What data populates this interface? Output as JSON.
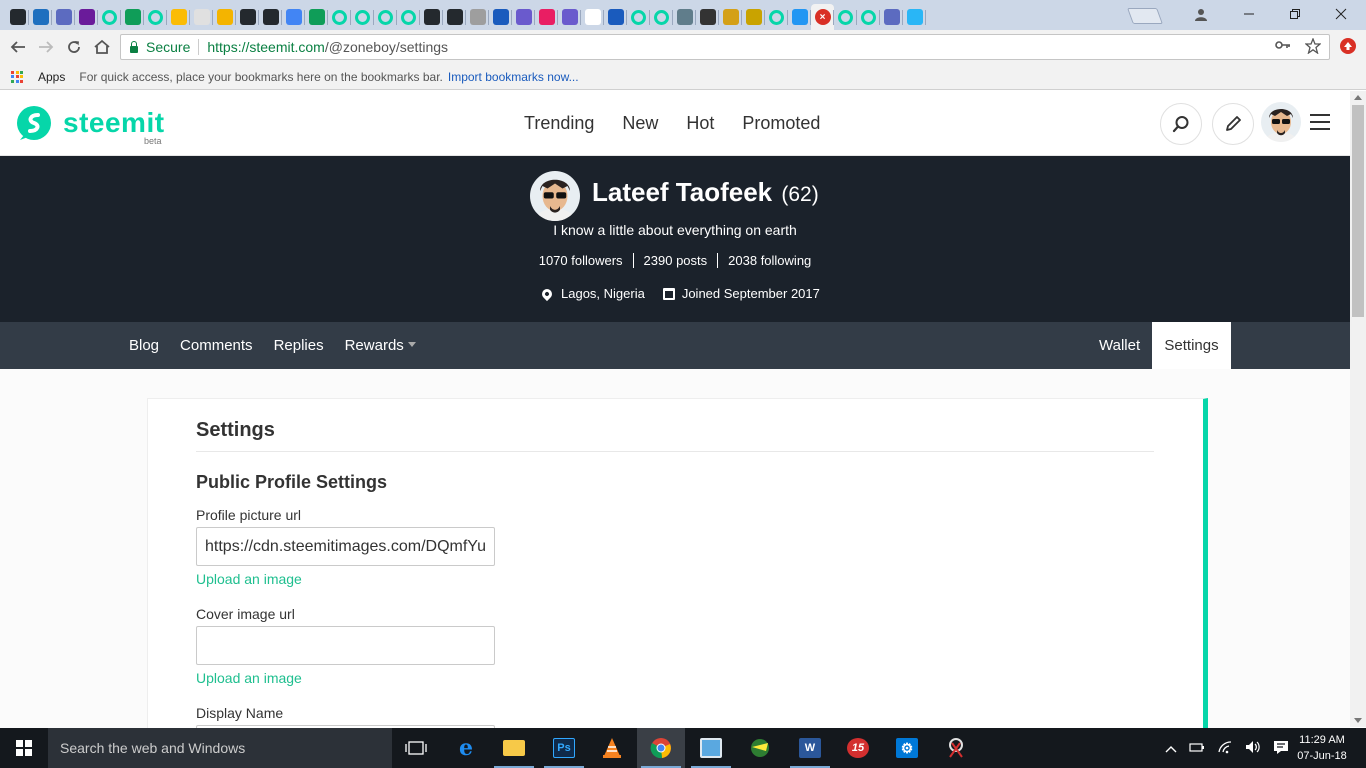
{
  "browser": {
    "tab_colors": [
      "#24292e",
      "#1e6fbf",
      "#5c6bc0",
      "#6a1b9a",
      "#06d6a9",
      "#0f9d58",
      "#06d6a9",
      "#fbbc05",
      "#e0e0e0",
      "#f4b400",
      "#24292e",
      "#24292e",
      "#4285f4",
      "#0f9d58",
      "#06d6a9",
      "#06d6a9",
      "#06d6a9",
      "#06d6a9",
      "#24292e",
      "#24292e",
      "#9e9e9e",
      "#1a5bbd",
      "#6a5acd",
      "#e91e63",
      "#6a5acd",
      "#ffffff",
      "#1a5bbd",
      "#06d6a9",
      "#06d6a9",
      "#607d8b",
      "#333333",
      "#d4a017",
      "#c9a300",
      "#06d6a9",
      "#2196f3",
      "#06d6a9",
      "#06d6a9",
      "#5c6bc0",
      "#29b6f6"
    ],
    "active_tab_icon": "close-icon",
    "omnibox": {
      "secure_label": "Secure",
      "url_host": "https://steemit.com",
      "url_path": "/@zoneboy/settings"
    },
    "bookmarks": {
      "apps_label": "Apps",
      "hint": "For quick access, place your bookmarks here on the bookmarks bar.",
      "import_link": "Import bookmarks now..."
    }
  },
  "site": {
    "logo_text": "steemit",
    "logo_badge": "beta",
    "brand_color": "#06d6a9",
    "nav": [
      "Trending",
      "New",
      "Hot",
      "Promoted"
    ]
  },
  "profile": {
    "name": "Lateef Taofeek",
    "reputation": "(62)",
    "about": "I know a little about everything on earth",
    "stats": [
      "1070 followers",
      "2390 posts",
      "2038 following"
    ],
    "location": "Lagos, Nigeria",
    "joined": "Joined September 2017"
  },
  "subnav": {
    "left": [
      "Blog",
      "Comments",
      "Replies",
      "Rewards"
    ],
    "wallet": "Wallet",
    "settings": "Settings"
  },
  "settings": {
    "title": "Settings",
    "section_title": "Public Profile Settings",
    "profile_picture_label": "Profile picture url",
    "profile_picture_value": "https://cdn.steemitimages.com/DQmfYu",
    "upload_label": "Upload an image",
    "cover_image_label": "Cover image url",
    "cover_image_value": "",
    "display_name_label": "Display Name"
  },
  "taskbar": {
    "search_placeholder": "Search the web and Windows",
    "time": "11:29 AM",
    "date": "07-Jun-18"
  }
}
